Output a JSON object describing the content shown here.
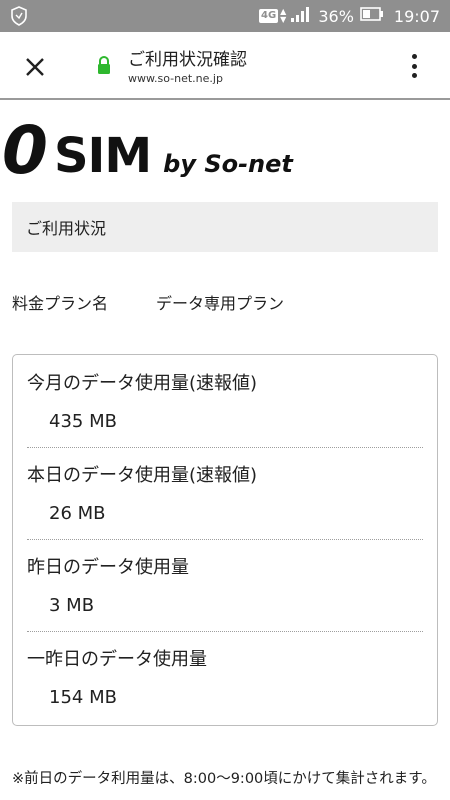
{
  "status_bar": {
    "network": "4G",
    "battery_percent": "36%",
    "time": "19:07"
  },
  "browser": {
    "page_title": "ご利用状況確認",
    "url": "www.so-net.ne.jp"
  },
  "logo": {
    "zero": "0",
    "sim": "SIM",
    "by": "by So-net"
  },
  "section": {
    "title": "ご利用状況"
  },
  "plan": {
    "label": "料金プラン名",
    "value": "データ専用プラン"
  },
  "usage": {
    "items": [
      {
        "label": "今月のデータ使用量(速報値)",
        "value": "435 MB"
      },
      {
        "label": "本日のデータ使用量(速報値)",
        "value": "26 MB"
      },
      {
        "label": "昨日のデータ使用量",
        "value": "3 MB"
      },
      {
        "label": "一昨日のデータ使用量",
        "value": "154 MB"
      }
    ]
  },
  "footnote": "※前日のデータ利用量は、8:00〜9:00頃にかけて集計されます。"
}
